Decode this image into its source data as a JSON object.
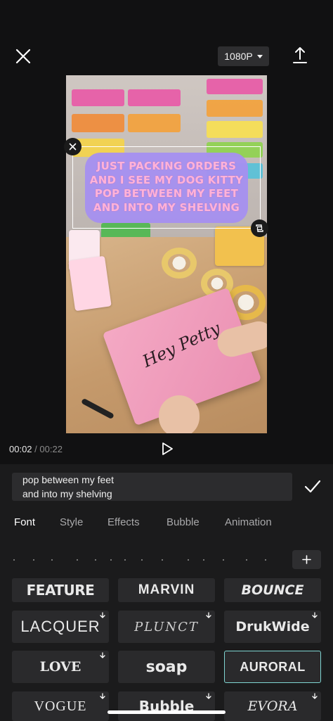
{
  "topbar": {
    "close_icon": "close-icon",
    "resolution_label": "1080P",
    "export_icon": "export-icon"
  },
  "caption": {
    "text": "JUST PACKING ORDERS\nAND I SEE MY DOG KITTY\nPOP BETWEEN MY FEET\nAND INTO MY SHELVING",
    "bubble_color": "#a58ff0",
    "text_color": "#ffb3d9"
  },
  "preview": {
    "package_label": "Hey Petty"
  },
  "playback": {
    "current_time": "00:02",
    "separator": "/",
    "total_time": "00:22"
  },
  "editor": {
    "text_value": "pop between my feet\nand into my shelving"
  },
  "tabs": [
    {
      "label": "Font",
      "active": true
    },
    {
      "label": "Style",
      "active": false
    },
    {
      "label": "Effects",
      "active": false
    },
    {
      "label": "Bubble",
      "active": false
    },
    {
      "label": "Animation",
      "active": false
    }
  ],
  "fonts": [
    {
      "label": "FEATURE",
      "download": false
    },
    {
      "label": "MARVIN",
      "download": false
    },
    {
      "label": "BOUNCE",
      "download": false
    },
    {
      "label": "LACQUER",
      "download": true
    },
    {
      "label": "PLUNCT",
      "download": true
    },
    {
      "label": "DrukWide",
      "download": true
    },
    {
      "label": "LOVE",
      "download": true
    },
    {
      "label": "soap",
      "download": false
    },
    {
      "label": "AURORAL",
      "download": false,
      "selected": true
    },
    {
      "label": "VOGUE",
      "download": true
    },
    {
      "label": "Bubble",
      "download": true
    },
    {
      "label": "EVORA",
      "download": true
    }
  ],
  "colors": {
    "background": "#111112",
    "panel": "#1b1b1c",
    "selected_border": "#7fd5d2"
  }
}
